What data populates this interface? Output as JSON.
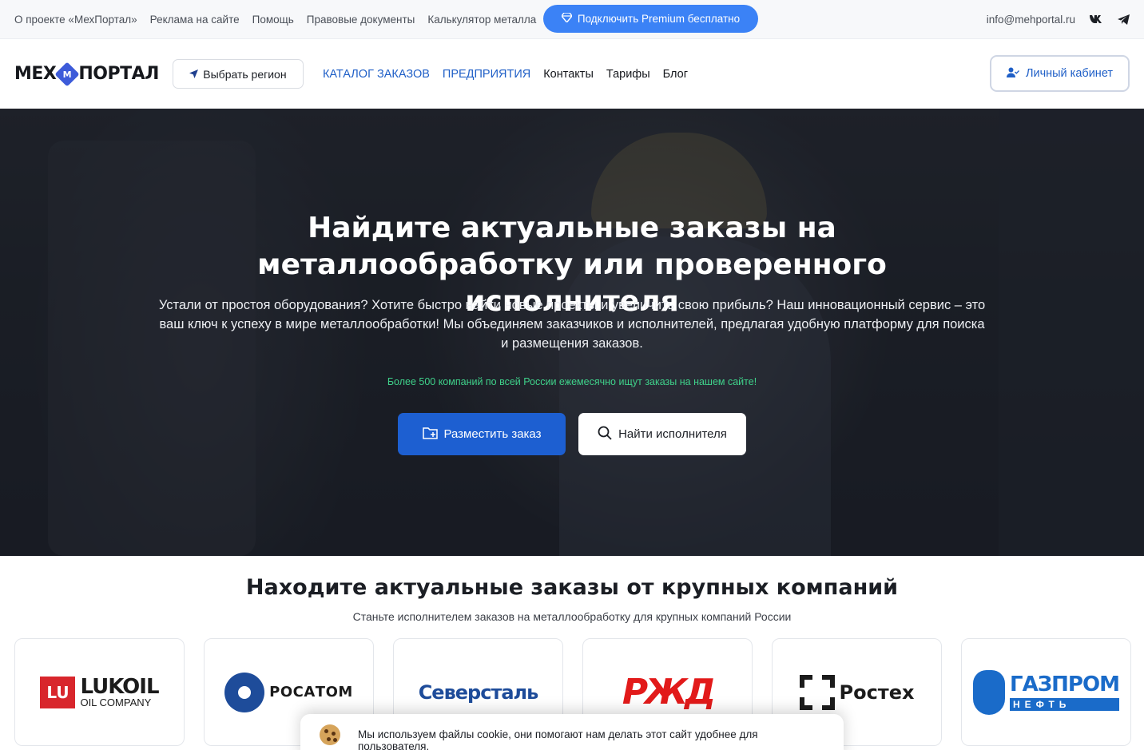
{
  "topbar": {
    "links": [
      "О проекте «МехПортал»",
      "Реклама на сайте",
      "Помощь",
      "Правовые документы",
      "Калькулятор металла"
    ],
    "premium_label": "Подключить Premium бесплатно",
    "email": "info@mehportal.ru",
    "social_icons": [
      "vk-icon",
      "telegram-icon"
    ]
  },
  "header": {
    "logo_left": "МЕХ",
    "logo_badge": "М",
    "logo_right": "ПОРТАЛ",
    "region_label": "Выбрать регион",
    "nav": [
      {
        "label": "КАТАЛОГ ЗАКАЗОВ",
        "accent": true
      },
      {
        "label": "ПРЕДПРИЯТИЯ",
        "accent": true
      },
      {
        "label": "Контакты",
        "accent": false
      },
      {
        "label": "Тарифы",
        "accent": false
      },
      {
        "label": "Блог",
        "accent": false
      }
    ],
    "cabinet_label": "Личный кабинет"
  },
  "hero": {
    "title": "Найдите актуальные заказы на металлообработку или проверенного исполнителя",
    "lead": "Устали от простоя оборудования? Хотите быстро найти новые проекты и увеличить свою прибыль? Наш инновационный сервис – это ваш ключ к успеху в мире металлообработки! Мы объединяем заказчиков и исполнителей, предлагая удобную платформу для поиска и размещения заказов.",
    "promo": "Более 500 компаний по всей России ежемесячно ищут заказы на нашем сайте!",
    "primary_button": "Разместить заказ",
    "secondary_button": "Найти исполнителя"
  },
  "companies": {
    "title": "Находите актуальные заказы от крупных компаний",
    "subtitle": "Станьте исполнителем заказов на металлообработку для крупных компаний России",
    "logos": {
      "lukoil": {
        "mark": "LU",
        "name": "LUKOIL",
        "sub": "OIL COMPANY"
      },
      "rosatom": {
        "name": "РОСАТОМ"
      },
      "severstal": {
        "name": "Северсталь"
      },
      "rzd": {
        "name": "РЖД"
      },
      "rostec": {
        "name": "Ростех"
      },
      "gazprom": {
        "name": "ГАЗПРОМ",
        "sub": "НЕФТЬ"
      }
    }
  },
  "cookie": {
    "text": "Мы используем файлы cookie, они помогают нам делать этот сайт удобнее для пользователя."
  },
  "colors": {
    "accent": "#1d5fd1",
    "premium": "#3b82f6",
    "promo_green": "#3fd18a"
  }
}
